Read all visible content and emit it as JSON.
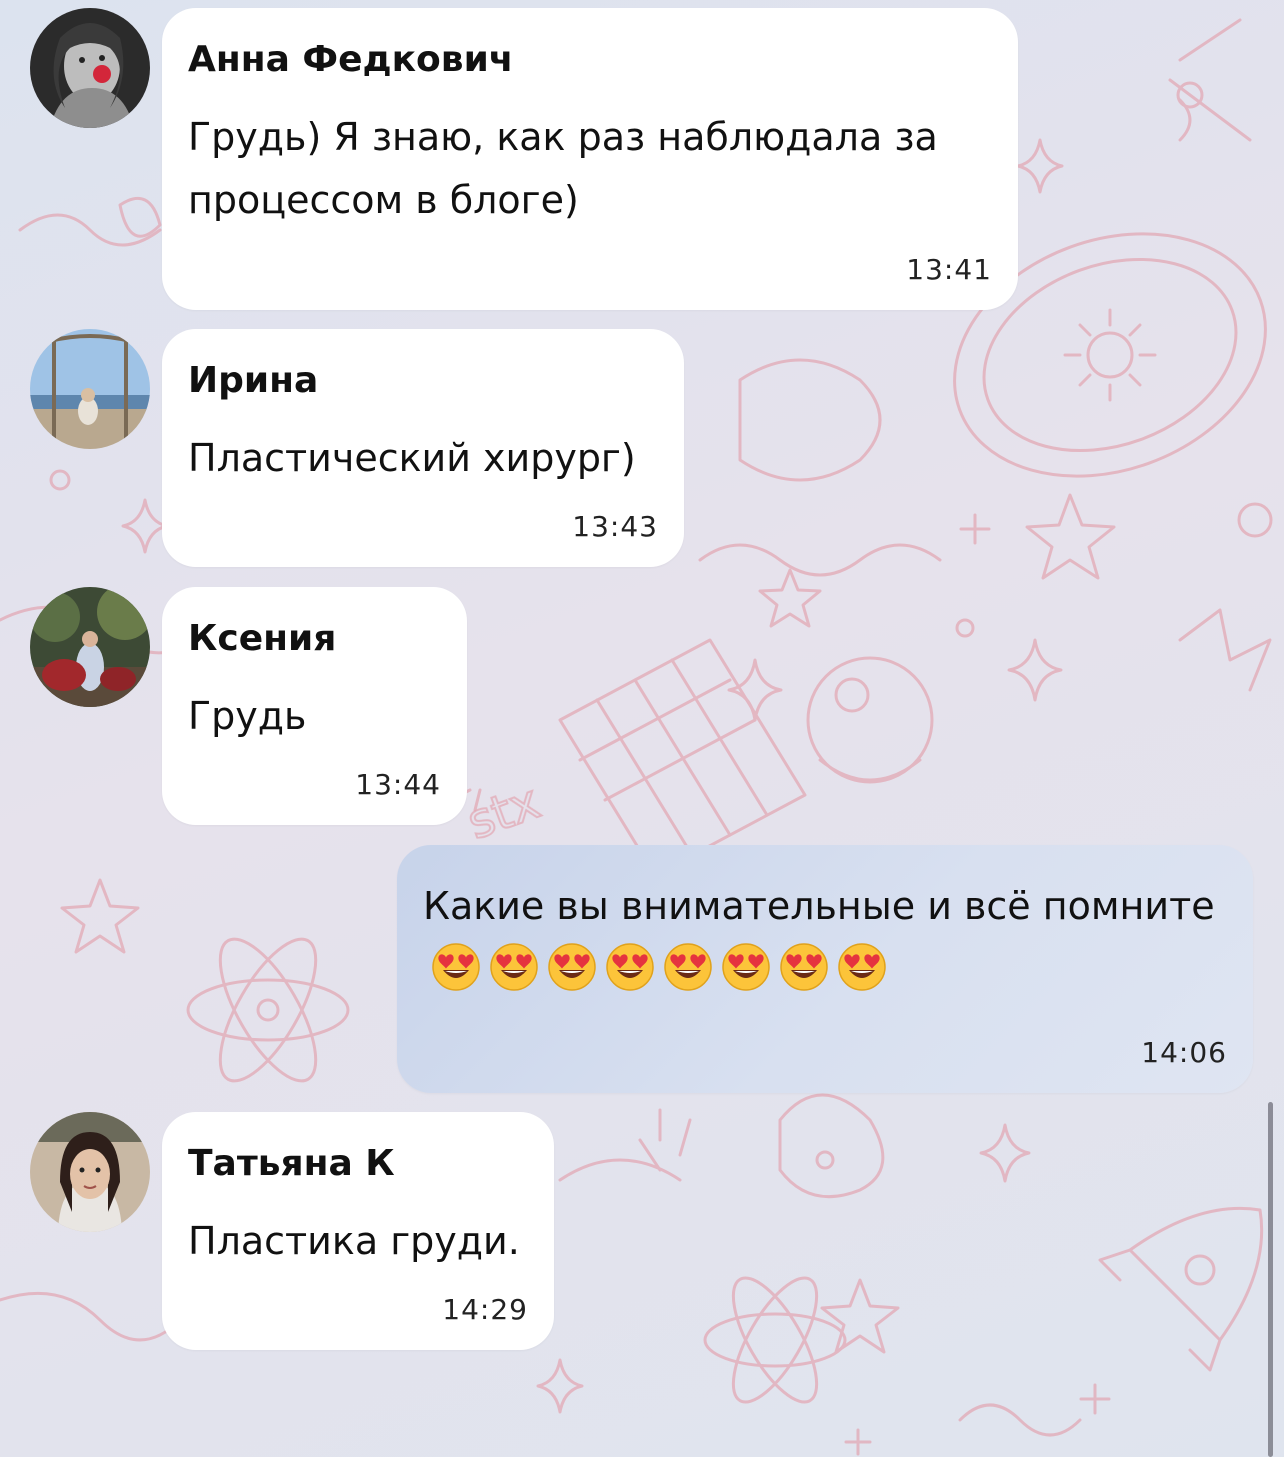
{
  "messages": [
    {
      "sender": "Анна Федкович",
      "text": "Грудь) Я знаю, как раз наблюдала за процессом в блоге)",
      "time": "13:41",
      "avatar": "avatar-anna"
    },
    {
      "sender": "Ирина",
      "text": "Пластический хирург)",
      "time": "13:43",
      "avatar": "avatar-irina"
    },
    {
      "sender": "Ксения",
      "text": "Грудь",
      "time": "13:44",
      "avatar": "avatar-ksenia"
    },
    {
      "text": "Какие вы внимательные и всё помните",
      "emoji": "heart-eyes-emoji",
      "emoji_count": 8,
      "time": "14:06",
      "outgoing": true
    },
    {
      "sender": "Татьяна К",
      "text": "Пластика груди.",
      "time": "14:29",
      "avatar": "avatar-tatiana"
    }
  ],
  "colors": {
    "background": "#dce3ef",
    "pattern": "#e0a7b4",
    "incoming_bubble": "#ffffff",
    "outgoing_bubble": "#d1dbee"
  }
}
